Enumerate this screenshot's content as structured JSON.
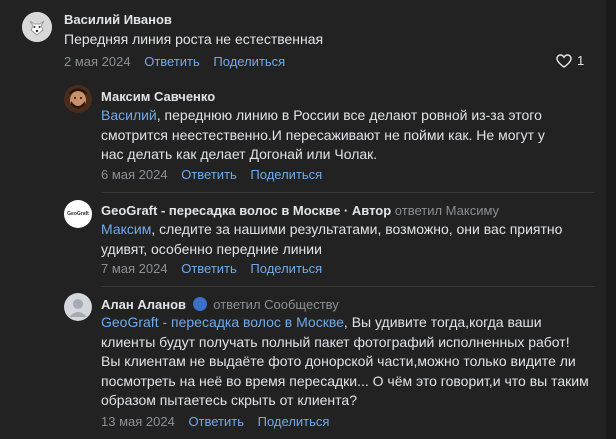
{
  "comments": [
    {
      "author": "Василий Иванов",
      "text": "Передняя линия роста не естественная",
      "date": "2 мая 2024",
      "reply_label": "Ответить",
      "share_label": "Поделиться",
      "likes": "1"
    },
    {
      "author": "Максим Савченко",
      "mention": "Василий",
      "text": ", переднюю линию в России все делают ровной из-за этого смотрится неестественно.И пересаживают не пойми как. Не могут у нас делать как делает Догонай или Чолак.",
      "date": "6 мая 2024",
      "reply_label": "Ответить",
      "share_label": "Поделиться"
    },
    {
      "author": "GeoGraft - пересадка волос в Москве · Автор",
      "replied_to": "ответил Максиму",
      "avatar_text": "GeoGraft",
      "mention": "Максим",
      "text": ", следите за нашими результатами, возможно, они вас приятно удивят, особенно передние линии",
      "date": "7 мая 2024",
      "reply_label": "Ответить",
      "share_label": "Поделиться"
    },
    {
      "author": "Алан Аланов",
      "replied_to": "ответил Сообществу",
      "mention": "GeoGraft - пересадка волос в Москве",
      "text": ", Вы удивите тогда,когда ваши клиенты будут получать полный пакет фотографий исполненных работ! Вы клиентам не выдаёте фото донорской части,можно только видите ли посмотреть на неё во время пересадки... О чём это говорит,и что вы таким образом пытаетесь скрыть от клиента?",
      "date": "13 мая 2024",
      "reply_label": "Ответить",
      "share_label": "Поделиться"
    }
  ],
  "colors": {
    "background": "#222222",
    "link": "#71aaeb",
    "muted": "#8c8f94",
    "text": "#e1e3e6"
  }
}
